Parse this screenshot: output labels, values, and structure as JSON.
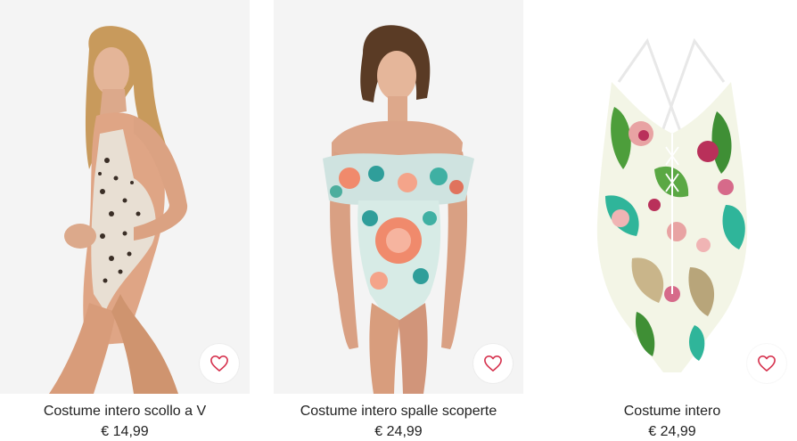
{
  "products": [
    {
      "name": "Costume intero scollo a V",
      "price": "€ 14,99",
      "image_alt": "Costume intero scollo a V leopardato"
    },
    {
      "name": "Costume intero spalle scoperte",
      "price": "€ 24,99",
      "image_alt": "Costume intero spalle scoperte floreale"
    },
    {
      "name": "Costume intero",
      "price": "€ 24,99",
      "image_alt": "Costume intero tropicale"
    }
  ],
  "colors": {
    "favorite_heart": "#d6334f",
    "image_background": "#f4f4f4",
    "text": "#222222"
  },
  "icons": {
    "favorite": "heart-outline-icon"
  }
}
